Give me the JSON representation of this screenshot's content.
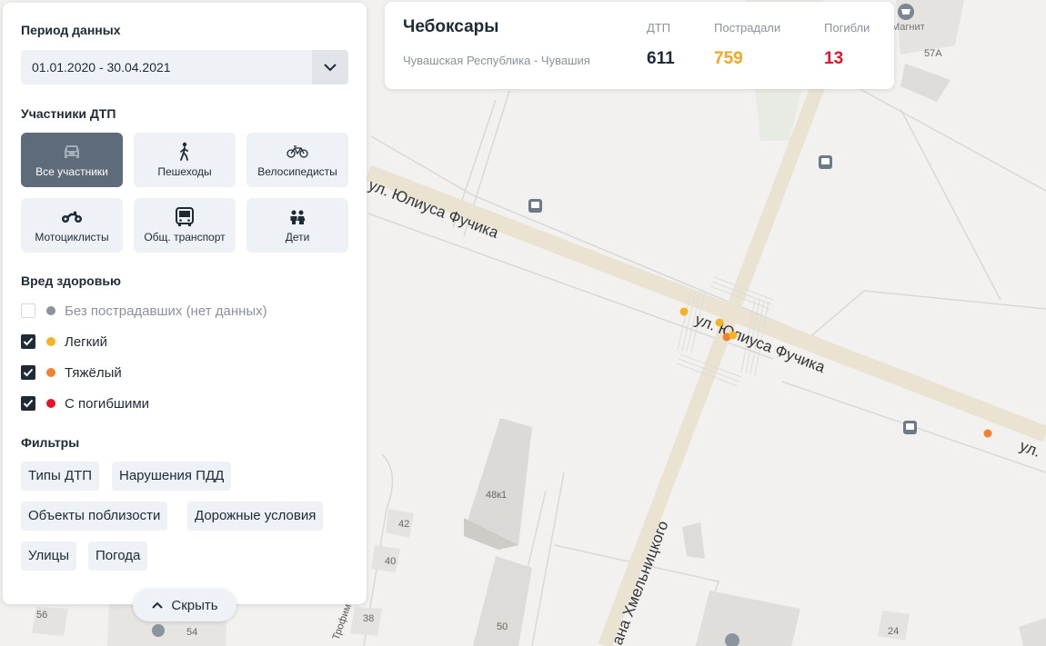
{
  "card": {
    "city": "Чебоксары",
    "region": "Чувашская Республика - Чувашия",
    "stats": [
      {
        "label": "ДТП",
        "value": "611",
        "color": "#1f2a37"
      },
      {
        "label": "Пострадали",
        "value": "759",
        "color": "#f5a623"
      },
      {
        "label": "Погибли",
        "value": "13",
        "color": "#e8132b"
      }
    ]
  },
  "panel": {
    "period_title": "Период данных",
    "period_value": "01.01.2020 - 30.04.2021",
    "participants_title": "Участники ДТП",
    "participants": [
      {
        "label": "Все участники",
        "icon": "car-icon",
        "active": true
      },
      {
        "label": "Пешеходы",
        "icon": "pedestrian-icon",
        "active": false
      },
      {
        "label": "Велосипедисты",
        "icon": "bicycle-icon",
        "active": false
      },
      {
        "label": "Мотоциклисты",
        "icon": "motorcycle-icon",
        "active": false
      },
      {
        "label": "Общ. транспорт",
        "icon": "bus-icon",
        "active": false
      },
      {
        "label": "Дети",
        "icon": "children-icon",
        "active": false
      }
    ],
    "health_title": "Вред здоровью",
    "health": [
      {
        "label": "Без пострадавших (нет данных)",
        "checked": false,
        "color": "#8a929c"
      },
      {
        "label": "Легкий",
        "checked": true,
        "color": "#f5b325"
      },
      {
        "label": "Тяжёлый",
        "checked": true,
        "color": "#f3812f"
      },
      {
        "label": "С погибшими",
        "checked": true,
        "color": "#e8132b"
      }
    ],
    "filters_title": "Фильтры",
    "filters": [
      "Типы ДТП",
      "Нарушения ПДД",
      "Объекты поблизости",
      "Дорожные условия",
      "Улицы",
      "Погода"
    ],
    "hide_label": "Скрыть"
  },
  "map": {
    "street_labels": [
      "ул. Юлиуса Фучика",
      "ул. Юлиуса Фучика",
      "ул.",
      "ана Хмельницкого",
      "Трофимова"
    ],
    "building_numbers": [
      "57А",
      "48к1",
      "42",
      "40",
      "38",
      "50",
      "56",
      "54",
      "24"
    ],
    "poi": [
      "Магнит"
    ],
    "incidents": [
      {
        "severity": "light",
        "color": "#f5b325"
      },
      {
        "severity": "light",
        "color": "#f5b325"
      },
      {
        "severity": "severe",
        "color": "#f3812f"
      },
      {
        "severity": "light",
        "color": "#f5b325"
      },
      {
        "severity": "severe",
        "color": "#f3812f"
      }
    ]
  }
}
